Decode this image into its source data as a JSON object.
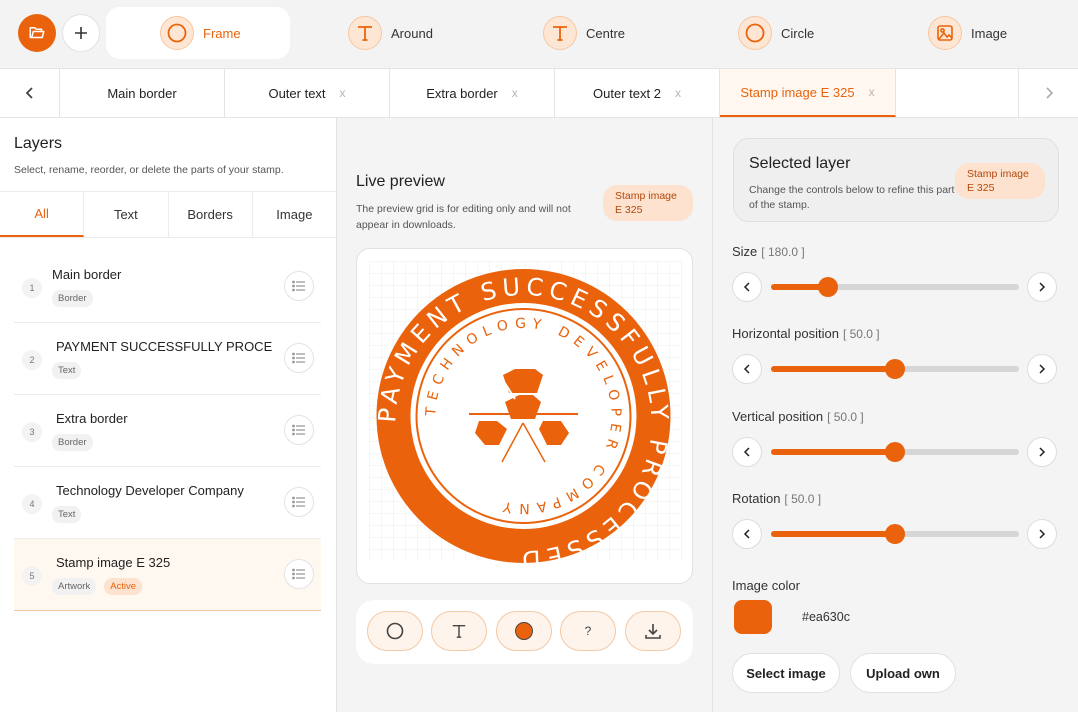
{
  "colors": {
    "accent": "#ea630c",
    "accent_soft": "#fde3cf"
  },
  "toolbar": {
    "open_icon": "folder-open-icon",
    "add_icon": "plus-icon",
    "modes": [
      {
        "label": "Frame",
        "icon": "circle-icon",
        "active": true
      },
      {
        "label": "Around",
        "icon": "text-T-icon",
        "active": false
      },
      {
        "label": "Centre",
        "icon": "text-T-icon",
        "active": false
      },
      {
        "label": "Circle",
        "icon": "circle-icon",
        "active": false
      },
      {
        "label": "Image",
        "icon": "image-icon",
        "active": false
      }
    ]
  },
  "tabs": {
    "items": [
      {
        "label": "Main border",
        "closable": false
      },
      {
        "label": "Outer text",
        "close": "x"
      },
      {
        "label": "Extra border",
        "close": "x"
      },
      {
        "label": "Outer text 2",
        "close": "x"
      },
      {
        "label": "Stamp image E 325",
        "close": "x",
        "active": true
      }
    ]
  },
  "layers": {
    "title": "Layers",
    "subtitle": "Select, rename, reorder, or delete the parts of your stamp.",
    "filters": [
      "All",
      "Text",
      "Borders",
      "Image"
    ],
    "items": [
      {
        "num": "1",
        "name": "Main border",
        "tag": "Border"
      },
      {
        "num": "2",
        "name": "PAYMENT SUCCESSFULLY PROCESSED",
        "tag": "Text"
      },
      {
        "num": "3",
        "name": "Extra border",
        "tag": "Border"
      },
      {
        "num": "4",
        "name": "Technology Developer Company",
        "tag": "Text"
      },
      {
        "num": "5",
        "name": "Stamp image E 325",
        "tag": "Artwork",
        "status": "Active"
      }
    ]
  },
  "preview": {
    "title": "Live preview",
    "subtitle": "The preview grid is for editing only and will not appear in downloads.",
    "badge": "Stamp image E 325",
    "outer_text": "PAYMENT SUCCESSFULLY PROCESSED",
    "inner_text": "TECHNOLOGY DEVELOPER COMPANY",
    "tools": [
      {
        "icon": "circle-icon"
      },
      {
        "icon": "text-T-icon"
      },
      {
        "icon": "filled-circle-icon"
      },
      {
        "icon": "help-icon",
        "label": "?"
      },
      {
        "icon": "download-icon"
      }
    ]
  },
  "selected": {
    "title": "Selected layer",
    "subtitle": "Change the controls below to refine this part of the stamp.",
    "badge": "Stamp image E 325",
    "controls": [
      {
        "label": "Size",
        "value": "[ 180.0 ]",
        "fraction": 0.23
      },
      {
        "label": "Horizontal position",
        "value": "[ 50.0 ]",
        "fraction": 0.5
      },
      {
        "label": "Vertical position",
        "value": "[ 50.0 ]",
        "fraction": 0.5
      },
      {
        "label": "Rotation",
        "value": "[ 50.0 ]",
        "fraction": 0.5
      }
    ],
    "color_label": "Image color",
    "color_value": "#ea630c",
    "select_image": "Select image",
    "upload_own": "Upload own"
  }
}
